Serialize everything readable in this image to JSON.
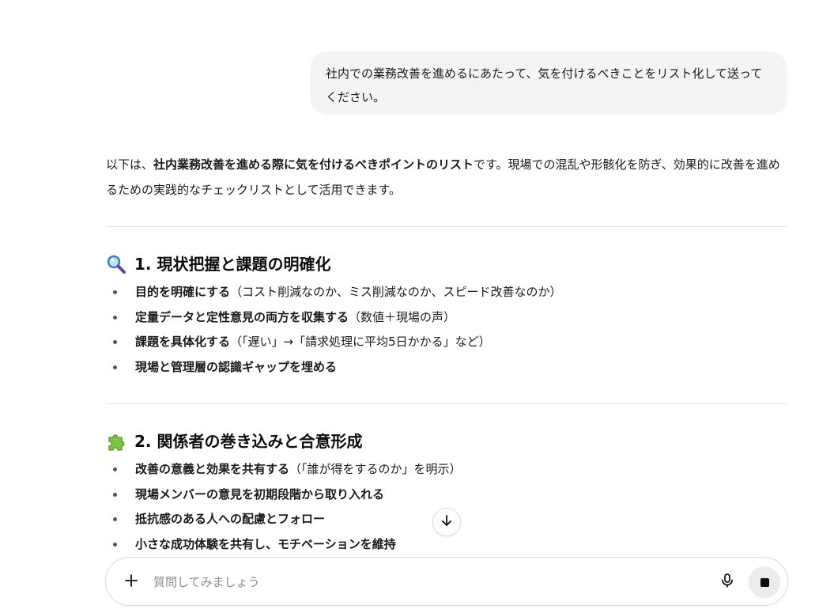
{
  "user_message": "社内での業務改善を進めるにあたって、気を付けるべきことをリスト化して送ってください。",
  "response": {
    "intro": {
      "prefix": "以下は、",
      "bold": "社内業務改善を進める際に気を付けるべきポイントのリスト",
      "suffix": "です。現場での混乱や形骸化を防ぎ、効果的に改善を進めるための実践的なチェックリストとして活用できます。"
    },
    "sections": [
      {
        "icon": "magnifying-glass-icon",
        "title": "1. 現状把握と課題の明確化",
        "items": [
          {
            "strong": "目的を明確にする",
            "rest": "（コスト削減なのか、ミス削減なのか、スピード改善なのか）"
          },
          {
            "strong": "定量データと定性意見の両方を収集する",
            "rest": "（数値＋現場の声）"
          },
          {
            "strong": "課題を具体化する",
            "rest": "（「遅い」→「請求処理に平均5日かかる」など）"
          },
          {
            "strong": "現場と管理層の認識ギャップを埋める",
            "rest": ""
          }
        ]
      },
      {
        "icon": "puzzle-piece-icon",
        "title": "2. 関係者の巻き込みと合意形成",
        "items": [
          {
            "strong": "改善の意義と効果を共有する",
            "rest": "（「誰が得をするのか」を明示）"
          },
          {
            "strong": "現場メンバーの意見を初期段階から取り入れる",
            "rest": ""
          },
          {
            "strong": "抵抗感のある人への配慮とフォロー",
            "rest": ""
          },
          {
            "strong": "小さな成功体験を共有し、モチベーションを維持",
            "rest": ""
          }
        ]
      }
    ]
  },
  "composer": {
    "placeholder": "質問してみましょう",
    "plus_icon": "plus-icon",
    "mic_icon": "microphone-icon",
    "stop_icon": "stop-icon"
  },
  "scroll_button_icon": "arrow-down-icon",
  "colors": {
    "user_bubble": "#f4f4f4",
    "text": "#1a1a1a",
    "placeholder": "#8f8f8f",
    "stop_button": "#ececec"
  }
}
